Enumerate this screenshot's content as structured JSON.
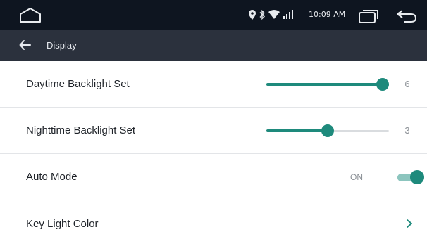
{
  "status_bar": {
    "time": "10:09 AM",
    "icons": [
      "location-icon",
      "bluetooth-icon",
      "wifi-icon",
      "signal-icon"
    ]
  },
  "nav_buttons": [
    "home-icon",
    "recents-icon",
    "back-icon"
  ],
  "toolbar": {
    "title": "Display",
    "back_icon": "arrow-left-icon"
  },
  "settings": {
    "daytime_backlight": {
      "label": "Daytime Backlight Set",
      "value": "6",
      "level": 1.0
    },
    "nighttime_backlight": {
      "label": "Nighttime Backlight Set",
      "value": "3",
      "level": 0.5
    },
    "auto_mode": {
      "label": "Auto Mode",
      "state": "ON",
      "on": true
    },
    "key_light_color": {
      "label": "Key Light Color",
      "chevron": "›"
    }
  },
  "colors": {
    "status_bar_bg": "#0e1520",
    "toolbar_bg": "#2b313d",
    "accent": "#1e8a7c",
    "accent_light": "#8cc5be",
    "track": "#d9dcdf",
    "divider": "#e3e5e8"
  }
}
